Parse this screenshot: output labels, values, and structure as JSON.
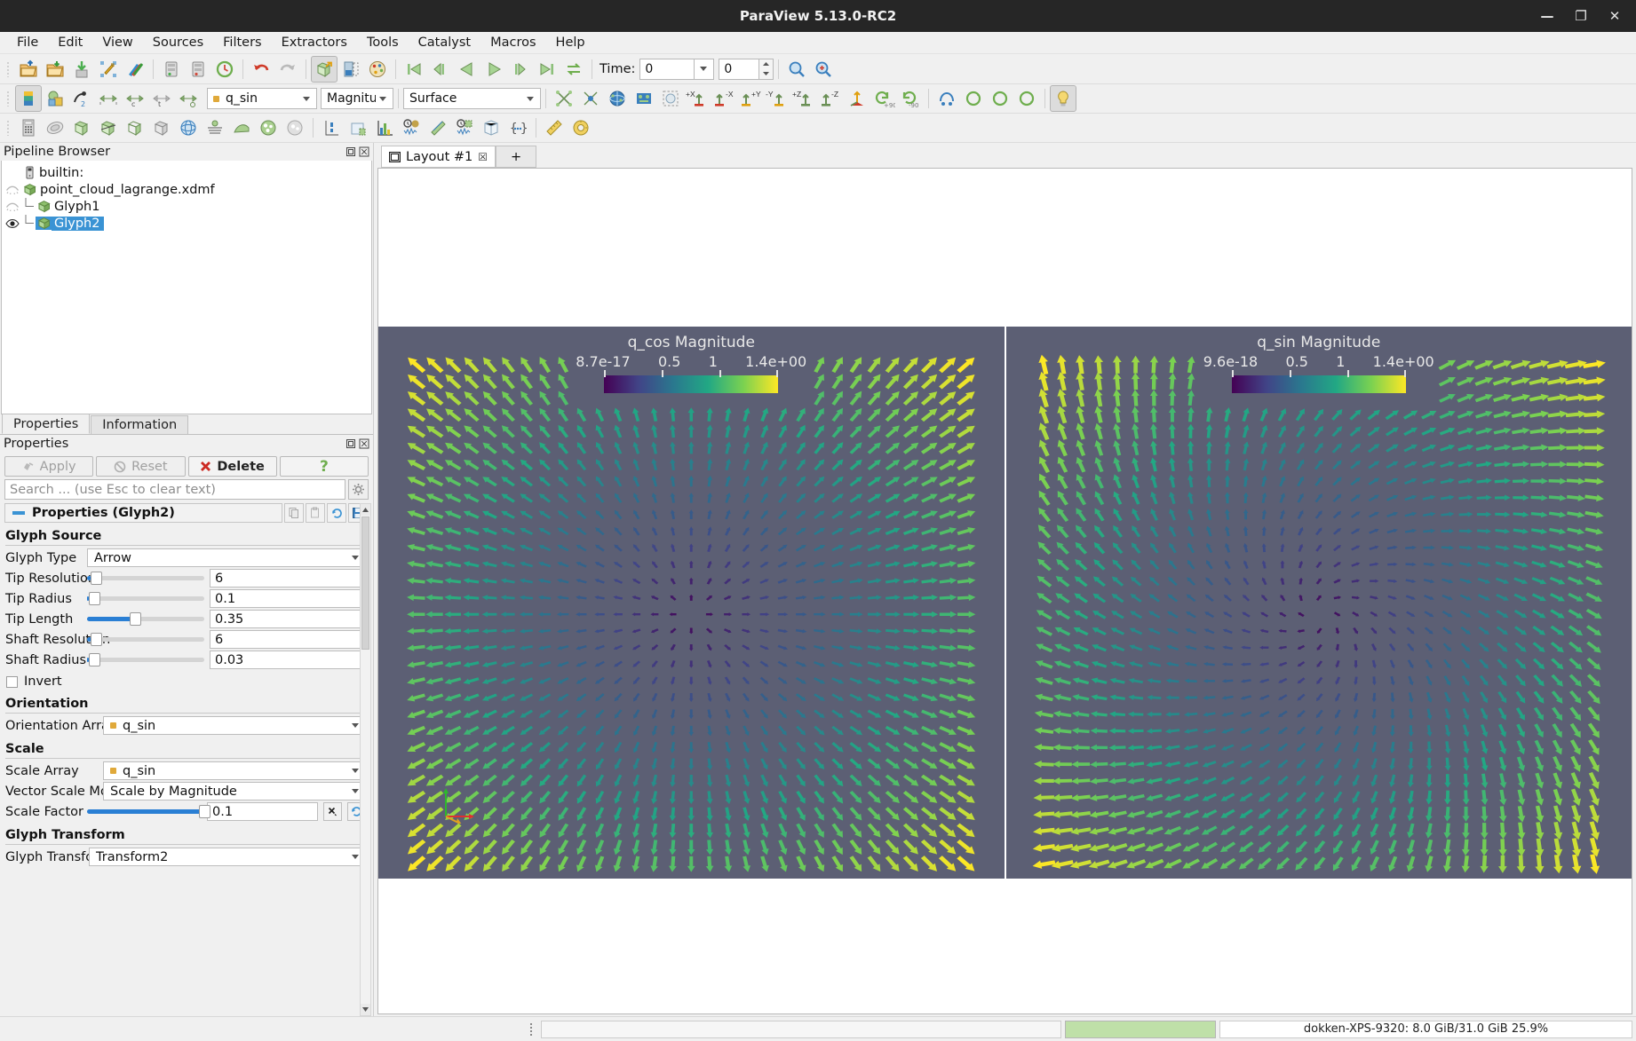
{
  "window": {
    "title": "ParaView 5.13.0-RC2",
    "minimize": "—",
    "maximize": "❐",
    "close": "✕"
  },
  "menubar": {
    "items": [
      "File",
      "Edit",
      "View",
      "Sources",
      "Filters",
      "Extractors",
      "Tools",
      "Catalyst",
      "Macros",
      "Help"
    ]
  },
  "toolbar_main": {
    "time_label": "Time:",
    "time_value": "0",
    "frame_value": "0"
  },
  "toolbar_repr": {
    "array_name": "q_sin",
    "component": "Magnitude",
    "representation": "Surface",
    "axis_buttons": [
      "+X",
      "-X",
      "+Y",
      "-Y",
      "+Z",
      "-Z"
    ],
    "rotate_labels": [
      "+90",
      "-90"
    ]
  },
  "pipeline_browser": {
    "title": "Pipeline Browser",
    "items": [
      {
        "label": "builtin:",
        "icon": "server-icon",
        "indent": 0,
        "selected": false,
        "eye": "none"
      },
      {
        "label": "point_cloud_lagrange.xdmf",
        "icon": "source-icon",
        "indent": 0,
        "selected": false,
        "eye": "hidden"
      },
      {
        "label": "Glyph1",
        "icon": "source-icon",
        "indent": 1,
        "selected": false,
        "eye": "hidden"
      },
      {
        "label": "Glyph2",
        "icon": "source-icon",
        "indent": 1,
        "selected": true,
        "eye": "visible"
      }
    ]
  },
  "panel_tabs": {
    "tabs": [
      "Properties",
      "Information"
    ],
    "active": "Properties"
  },
  "properties_panel": {
    "title": "Properties",
    "buttons": {
      "apply": "Apply",
      "reset": "Reset",
      "delete": "Delete",
      "help": "?"
    },
    "search_placeholder": "Search ... (use Esc to clear text)",
    "header": "Properties (Glyph2)",
    "groups": [
      {
        "name": "Glyph Source",
        "rows": [
          {
            "kind": "combo",
            "label": "Glyph Type",
            "value": "Arrow"
          },
          {
            "kind": "slider",
            "label": "Tip Resolution",
            "value": "6",
            "fill_pct": 3
          },
          {
            "kind": "slider",
            "label": "Tip Radius",
            "value": "0.1",
            "fill_pct": 1
          },
          {
            "kind": "slider",
            "label": "Tip Length",
            "value": "0.35",
            "fill_pct": 35
          },
          {
            "kind": "slider",
            "label": "Shaft Resolution",
            "value": "6",
            "fill_pct": 3
          },
          {
            "kind": "slider",
            "label": "Shaft Radius",
            "value": "0.03",
            "fill_pct": 1
          },
          {
            "kind": "check",
            "label": "Invert",
            "checked": false
          }
        ]
      },
      {
        "name": "Orientation",
        "rows": [
          {
            "kind": "arraycombo",
            "label": "Orientation Array",
            "value": "q_sin"
          }
        ]
      },
      {
        "name": "Scale",
        "rows": [
          {
            "kind": "arraycombo",
            "label": "Scale Array",
            "value": "q_sin"
          },
          {
            "kind": "combo",
            "label": "Vector Scale Mode",
            "value": "Scale by Magnitude"
          },
          {
            "kind": "sliderx",
            "label": "Scale Factor",
            "value": "0.1",
            "fill_pct": 93,
            "reset_label": "x"
          }
        ]
      },
      {
        "name": "Glyph Transform",
        "rows": [
          {
            "kind": "combo",
            "label": "Glyph Transform",
            "value": "Transform2"
          }
        ]
      }
    ]
  },
  "layout": {
    "tab_label": "Layout #1",
    "tab_close": "☒",
    "new_tab": "+"
  },
  "render_views": [
    {
      "id": "view-left",
      "scalar_bar_title": "q_cos Magnitude",
      "tick_labels": [
        "8.7e-17",
        "0.5",
        "1",
        "1.4e+00"
      ],
      "field": "q_cos",
      "pattern": "radial",
      "background": "#5c5f74"
    },
    {
      "id": "view-right",
      "scalar_bar_title": "q_sin Magnitude",
      "tick_labels": [
        "9.6e-18",
        "0.5",
        "1",
        "1.4e+00"
      ],
      "field": "q_sin",
      "pattern": "swirl",
      "background": "#5c5f74"
    }
  ],
  "colormap": {
    "name": "viridis",
    "stops": [
      "#440154",
      "#414487",
      "#2a788e",
      "#22a884",
      "#7ad151",
      "#fde725"
    ]
  },
  "statusbar": {
    "message": "",
    "progress_pct": 100,
    "memory": "dokken-XPS-9320: 8.0 GiB/31.0 GiB 25.9%"
  },
  "colors": {
    "accent": "#3a93d4",
    "slider_fill": "#2a7fd4",
    "panel_bg": "#f0f0f0",
    "view_bg": "#5c5f74",
    "title_bg": "#262626"
  }
}
